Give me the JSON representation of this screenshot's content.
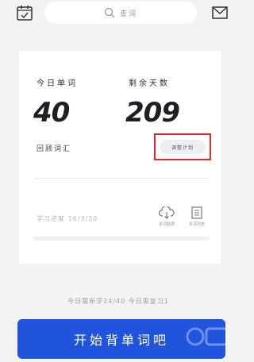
{
  "header": {
    "search_placeholder": "查词",
    "calendar_icon": "calendar-icon",
    "mail_icon": "mail-icon"
  },
  "stats": {
    "today_label": "今日单词",
    "today_value": "40",
    "remaining_label": "剩余天数",
    "remaining_value": "209"
  },
  "review": {
    "label": "回顾词汇",
    "adjust_label": "调整计划"
  },
  "progress": {
    "label": "学习进度 16/3/30",
    "fraction": 0.0,
    "tools": [
      {
        "label": "单词数据",
        "icon": "cloud-download-icon"
      },
      {
        "label": "单词列表",
        "icon": "list-doc-icon"
      }
    ]
  },
  "summary_text": "今日需新学24/40 今日需复习1",
  "start_button": "开始背单词吧",
  "colors": {
    "accent": "#2054dd",
    "highlight_box": "#e12a2a",
    "background": "#f3f3f5"
  }
}
